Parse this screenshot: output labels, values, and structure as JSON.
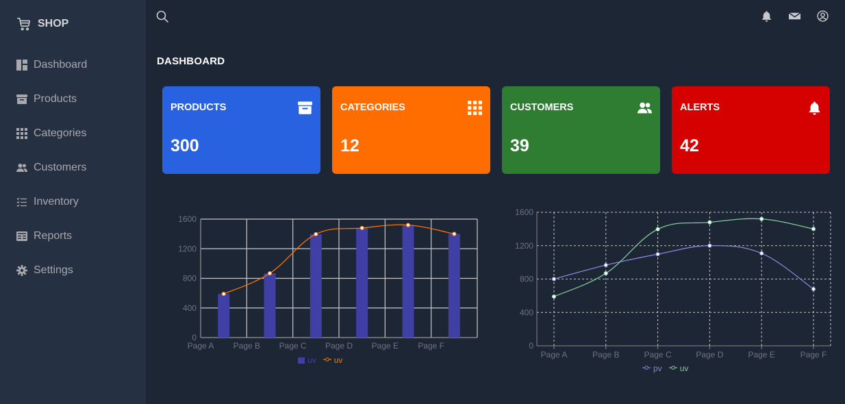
{
  "sidebar": {
    "brand": "SHOP",
    "items": [
      {
        "label": "Dashboard",
        "icon": "dashboard-icon"
      },
      {
        "label": "Products",
        "icon": "archive-icon"
      },
      {
        "label": "Categories",
        "icon": "grid-icon"
      },
      {
        "label": "Customers",
        "icon": "people-icon"
      },
      {
        "label": "Inventory",
        "icon": "list-check-icon"
      },
      {
        "label": "Reports",
        "icon": "report-icon"
      },
      {
        "label": "Settings",
        "icon": "gear-icon"
      }
    ]
  },
  "header": {
    "icons": [
      "search-icon",
      "bell-icon",
      "mail-icon",
      "user-circle-icon"
    ]
  },
  "main": {
    "title": "DASHBOARD",
    "cards": [
      {
        "label": "PRODUCTS",
        "value": "300",
        "color": "#2962e0",
        "icon": "archive-icon"
      },
      {
        "label": "CATEGORIES",
        "value": "12",
        "color": "#ff6d00",
        "icon": "grid-icon"
      },
      {
        "label": "CUSTOMERS",
        "value": "39",
        "color": "#2e7d32",
        "icon": "people-icon"
      },
      {
        "label": "ALERTS",
        "value": "42",
        "color": "#d50000",
        "icon": "bell-icon"
      }
    ]
  },
  "chart_data": [
    {
      "type": "bar",
      "categories": [
        "Page A",
        "Page B",
        "Page C",
        "Page D",
        "Page E",
        "Page F"
      ],
      "ylim": [
        0,
        1600
      ],
      "yticks": [
        0,
        400,
        800,
        1200,
        1600
      ],
      "grid": true,
      "legend": "bottom",
      "series": [
        {
          "name": "uv",
          "kind": "bar",
          "color": "#3f3fa6",
          "values": [
            590,
            868,
            1397,
            1480,
            1520,
            1400
          ]
        },
        {
          "name": "uv",
          "kind": "line",
          "color": "#ff7300",
          "values": [
            590,
            868,
            1397,
            1480,
            1520,
            1400
          ]
        }
      ]
    },
    {
      "type": "line",
      "categories": [
        "Page A",
        "Page B",
        "Page C",
        "Page D",
        "Page E",
        "Page F"
      ],
      "ylim": [
        0,
        1600
      ],
      "yticks": [
        0,
        400,
        800,
        1200,
        1600
      ],
      "grid": true,
      "grid_style": "dashed",
      "legend": "bottom",
      "series": [
        {
          "name": "pv",
          "color": "#8884d8",
          "values": [
            800,
            967,
            1098,
            1200,
            1108,
            680
          ]
        },
        {
          "name": "uv",
          "color": "#82ca9d",
          "values": [
            590,
            868,
            1397,
            1480,
            1520,
            1400
          ]
        }
      ]
    }
  ]
}
